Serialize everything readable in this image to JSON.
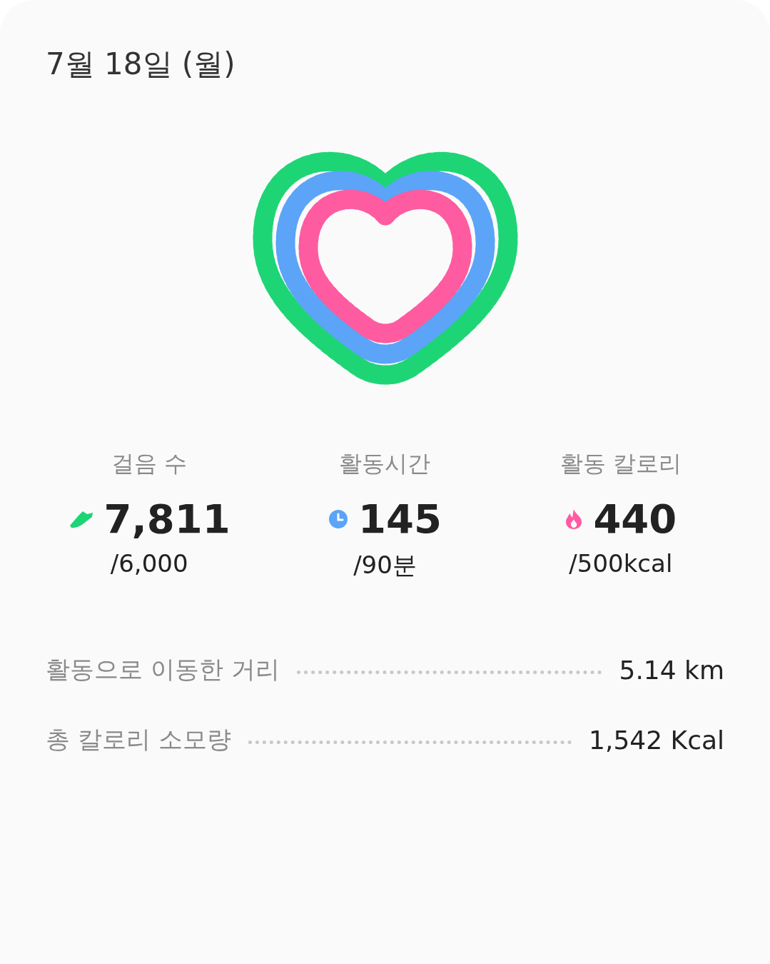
{
  "date": "7월 18일 (월)",
  "stats": [
    {
      "kind": "steps",
      "label": "걸음 수",
      "value": "7,811",
      "goal": "/6,000",
      "color": "#1ed576"
    },
    {
      "kind": "time",
      "label": "활동시간",
      "value": "145",
      "goal": "/90분",
      "color": "#5ba4f8"
    },
    {
      "kind": "calories",
      "label": "활동 칼로리",
      "value": "440",
      "goal": "/500kcal",
      "color": "#ff5ba0"
    }
  ],
  "summary": [
    {
      "label": "활동으로 이동한 거리",
      "value": "5.14 km"
    },
    {
      "label": "총 칼로리 소모량",
      "value": "1,542 Kcal"
    }
  ]
}
